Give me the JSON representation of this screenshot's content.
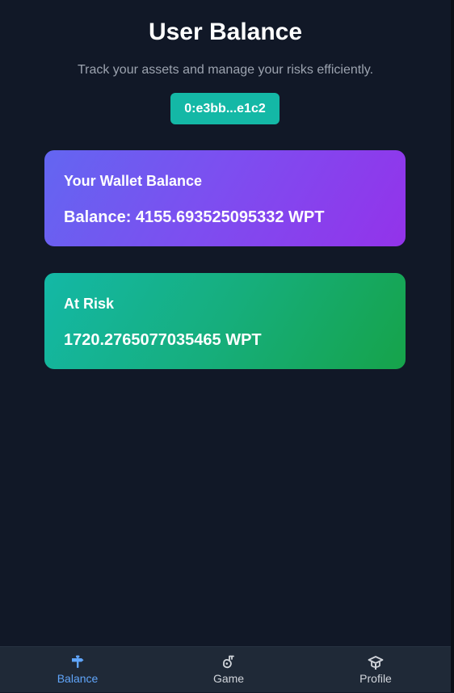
{
  "header": {
    "title": "User Balance",
    "subtitle": "Track your assets and manage your risks efficiently."
  },
  "wallet_button": {
    "label": "0:e3bb...e1c2"
  },
  "cards": {
    "balance": {
      "label": "Your Wallet Balance",
      "value": "Balance: 4155.693525095332 WPT"
    },
    "risk": {
      "label": "At Risk",
      "value": "1720.2765077035465 WPT"
    }
  },
  "nav": {
    "items": [
      {
        "label": "Balance",
        "icon": "signpost-icon",
        "active": true
      },
      {
        "label": "Game",
        "icon": "game-icon",
        "active": false
      },
      {
        "label": "Profile",
        "icon": "graduation-cap-icon",
        "active": false
      }
    ]
  },
  "colors": {
    "background": "#111827",
    "accent_teal": "#14b8a6",
    "active_nav": "#60a5fa",
    "nav_background": "#1f2937"
  }
}
